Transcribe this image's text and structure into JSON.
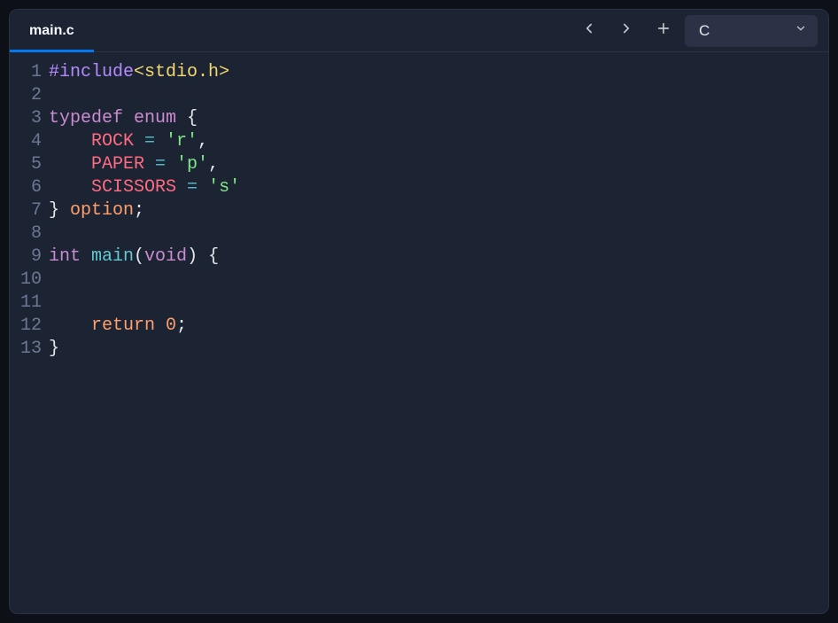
{
  "tab": {
    "filename": "main.c"
  },
  "language_selector": {
    "selected": "C"
  },
  "code_lines": [
    {
      "n": 1,
      "tokens": [
        {
          "cls": "tok-macro",
          "text": "#include"
        },
        {
          "cls": "tok-header",
          "text": "<stdio.h>"
        }
      ]
    },
    {
      "n": 2,
      "tokens": []
    },
    {
      "n": 3,
      "tokens": [
        {
          "cls": "tok-keyword",
          "text": "typedef "
        },
        {
          "cls": "tok-keyword",
          "text": "enum "
        },
        {
          "cls": "tok-punct",
          "text": "{"
        }
      ]
    },
    {
      "n": 4,
      "tokens": [
        {
          "cls": "",
          "text": "    "
        },
        {
          "cls": "tok-const",
          "text": "ROCK "
        },
        {
          "cls": "tok-op",
          "text": "= "
        },
        {
          "cls": "tok-string",
          "text": "'r'"
        },
        {
          "cls": "tok-punct",
          "text": ","
        }
      ]
    },
    {
      "n": 5,
      "tokens": [
        {
          "cls": "",
          "text": "    "
        },
        {
          "cls": "tok-const",
          "text": "PAPER "
        },
        {
          "cls": "tok-op",
          "text": "= "
        },
        {
          "cls": "tok-string",
          "text": "'p'"
        },
        {
          "cls": "tok-punct",
          "text": ","
        }
      ]
    },
    {
      "n": 6,
      "tokens": [
        {
          "cls": "",
          "text": "    "
        },
        {
          "cls": "tok-const",
          "text": "SCISSORS "
        },
        {
          "cls": "tok-op",
          "text": "= "
        },
        {
          "cls": "tok-string",
          "text": "'s'"
        }
      ]
    },
    {
      "n": 7,
      "tokens": [
        {
          "cls": "tok-punct",
          "text": "} "
        },
        {
          "cls": "tok-ret",
          "text": "option"
        },
        {
          "cls": "tok-punct",
          "text": ";"
        }
      ]
    },
    {
      "n": 8,
      "tokens": []
    },
    {
      "n": 9,
      "tokens": [
        {
          "cls": "tok-type",
          "text": "int "
        },
        {
          "cls": "tok-func",
          "text": "main"
        },
        {
          "cls": "tok-punct",
          "text": "("
        },
        {
          "cls": "tok-type",
          "text": "void"
        },
        {
          "cls": "tok-punct",
          "text": ") {"
        }
      ]
    },
    {
      "n": 10,
      "tokens": []
    },
    {
      "n": 11,
      "tokens": []
    },
    {
      "n": 12,
      "tokens": [
        {
          "cls": "",
          "text": "    "
        },
        {
          "cls": "tok-ret",
          "text": "return "
        },
        {
          "cls": "tok-num",
          "text": "0"
        },
        {
          "cls": "tok-punct",
          "text": ";"
        }
      ]
    },
    {
      "n": 13,
      "tokens": [
        {
          "cls": "tok-punct",
          "text": "}"
        }
      ]
    }
  ]
}
